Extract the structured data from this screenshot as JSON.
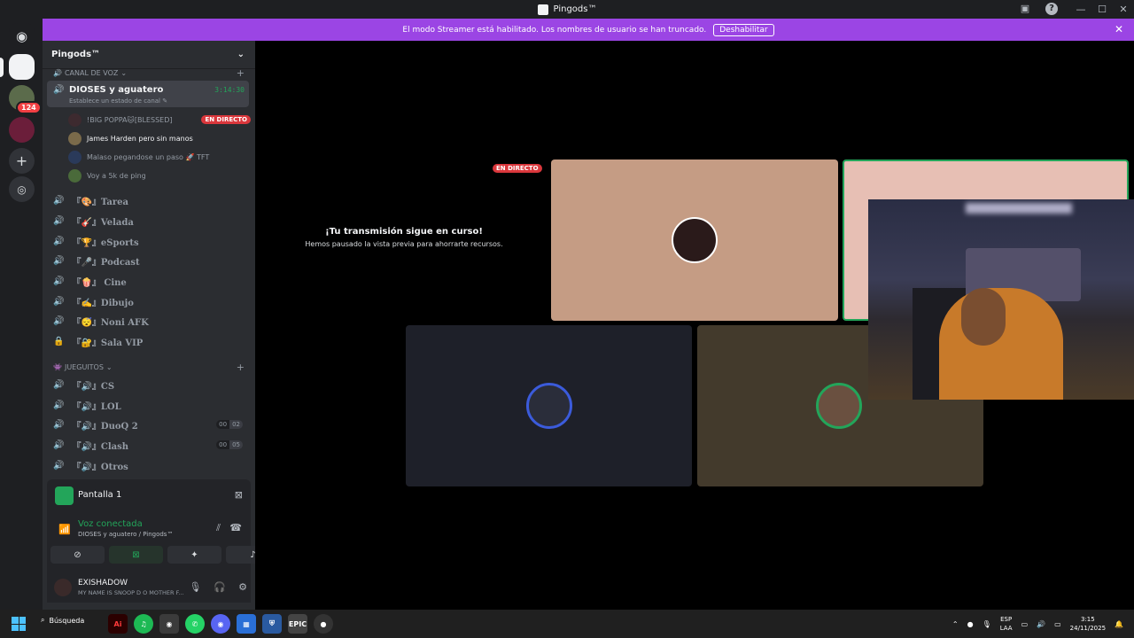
{
  "window": {
    "title": "Pingods™"
  },
  "banner": {
    "text": "El modo Streamer está habilitado. Los nombres de usuario se han truncado.",
    "button": "Deshabilitar"
  },
  "rail": {
    "badge_count": "124"
  },
  "server": {
    "name": "Pingods™"
  },
  "categories": {
    "voice": "CANAL DE VOZ",
    "games": "JUEGUITOS"
  },
  "active_channel": {
    "name": "DIOSES y aguatero",
    "time": "3:14:30",
    "status": "Establece un estado de canal"
  },
  "members": [
    {
      "name": "!BIG POPPA🐱[BLESSED]",
      "live": "EN DIRECTO"
    },
    {
      "name": "James Harden pero sin manos"
    },
    {
      "name": "Malaso pegandose un paso 🚀 TFT"
    },
    {
      "name": "Voy a 5k de ping"
    }
  ],
  "channels": [
    {
      "name": "『🎨』Tarea"
    },
    {
      "name": "『🎸』Velada"
    },
    {
      "name": "『🏆』eSports"
    },
    {
      "name": "『🎤』Podcast"
    },
    {
      "name": "『🍿』 Cine"
    },
    {
      "name": "『✍️』Dibujo"
    },
    {
      "name": "『😴』Noni AFK"
    },
    {
      "name": "『🔐』Sala VIP"
    }
  ],
  "game_channels": [
    {
      "name": "『🔊』CS"
    },
    {
      "name": "『🔊』LOL"
    },
    {
      "name": "『🔊』DuoQ 2",
      "c1": "00",
      "c2": "02"
    },
    {
      "name": "『🔊』Clash",
      "c1": "00",
      "c2": "05"
    },
    {
      "name": "『🔊』Otros"
    }
  ],
  "stream_panel": {
    "label": "Pantalla 1"
  },
  "voice_panel": {
    "title": "Voz conectada",
    "subtitle": "DIOSES y aguatero / Pingods™"
  },
  "user": {
    "name": "EXISHADOW",
    "status": "MY NAME IS SNOOP D O MOTHER F..."
  },
  "stage": {
    "live_badge": "EN DIRECTO",
    "paused_title": "¡Tu transmisión sigue en curso!",
    "paused_sub": "Hemos pausado la vista previa para ahorrarte recursos."
  },
  "taskbar": {
    "search": "Búsqueda",
    "lang1": "ESP",
    "lang2": "LAA",
    "time": "3:15",
    "date": "24/11/2025"
  },
  "colors": {
    "accent": "#9b45e4",
    "green": "#23a55a",
    "red": "#da373c"
  }
}
